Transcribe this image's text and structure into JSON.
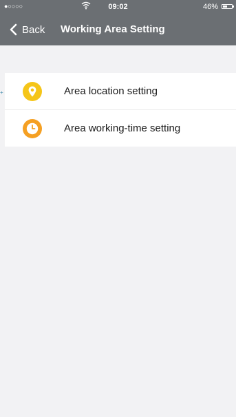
{
  "status_bar": {
    "signal": "●○○○○",
    "time": "09:02",
    "battery_percent": "46%",
    "battery_level": 0.46
  },
  "nav_bar": {
    "back_label": "Back",
    "title": "Working Area Setting"
  },
  "menu": {
    "items": [
      {
        "label": "Area location setting",
        "icon": "location-pin-icon",
        "color": "#f5c518"
      },
      {
        "label": "Area working-time setting",
        "icon": "clock-icon",
        "color": "#f5a023"
      }
    ]
  },
  "colors": {
    "nav_background": "#6b6f73",
    "page_background": "#f2f2f4"
  }
}
